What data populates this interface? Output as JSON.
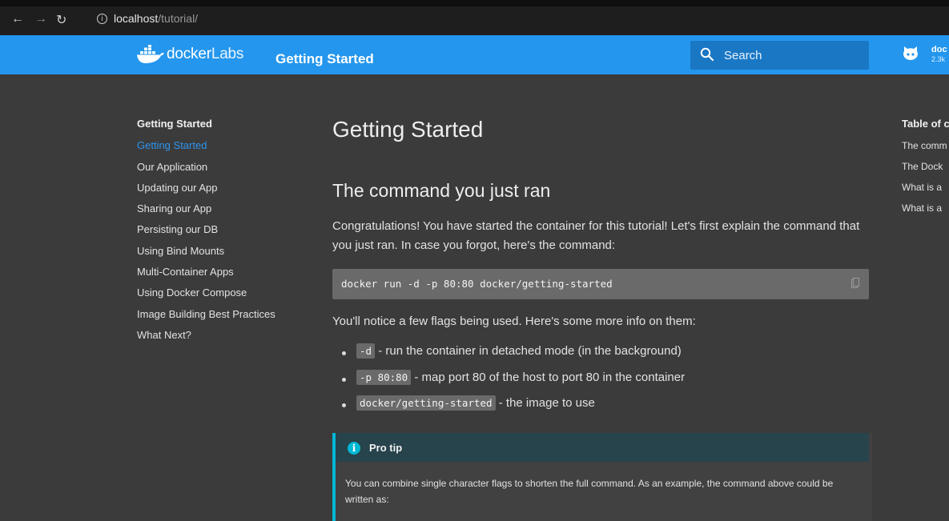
{
  "browser": {
    "url_host": "localhost",
    "url_path": "/tutorial/"
  },
  "header": {
    "brand_docker": "docker",
    "brand_labs": "Labs",
    "title": "Getting Started",
    "search_placeholder": "Search",
    "repo_name": "doc",
    "repo_stars": "2.3k"
  },
  "sidebar": {
    "title": "Getting Started",
    "items": [
      {
        "label": "Getting Started"
      },
      {
        "label": "Our Application"
      },
      {
        "label": "Updating our App"
      },
      {
        "label": "Sharing our App"
      },
      {
        "label": "Persisting our DB"
      },
      {
        "label": "Using Bind Mounts"
      },
      {
        "label": "Multi-Container Apps"
      },
      {
        "label": "Using Docker Compose"
      },
      {
        "label": "Image Building Best Practices"
      },
      {
        "label": "What Next?"
      }
    ]
  },
  "main": {
    "h1": "Getting Started",
    "h2": "The command you just ran",
    "intro": "Congratulations! You have started the container for this tutorial! Let's first explain the command that you just ran. In case you forgot, here's the command:",
    "command": "docker run -d -p 80:80 docker/getting-started",
    "flags_intro": "You'll notice a few flags being used. Here's some more info on them:",
    "bullets": [
      {
        "code": "-d",
        "text": " - run the container in detached mode (in the background)"
      },
      {
        "code": "-p 80:80",
        "text": " - map port 80 of the host to port 80 in the container"
      },
      {
        "code": "docker/getting-started",
        "text": " - the image to use"
      }
    ],
    "pro_tip": {
      "title": "Pro tip",
      "body": "You can combine single character flags to shorten the full command. As an example, the command above could be written as:"
    }
  },
  "toc": {
    "title": "Table of c",
    "items": [
      {
        "label": "The comm"
      },
      {
        "label": "The Dock"
      },
      {
        "label": "What is a"
      },
      {
        "label": "What is a"
      }
    ]
  },
  "colors": {
    "header": "#2496ed",
    "background": "#3b3b3b",
    "active_link": "#2d96ef",
    "admonition_accent": "#00b8d4"
  }
}
